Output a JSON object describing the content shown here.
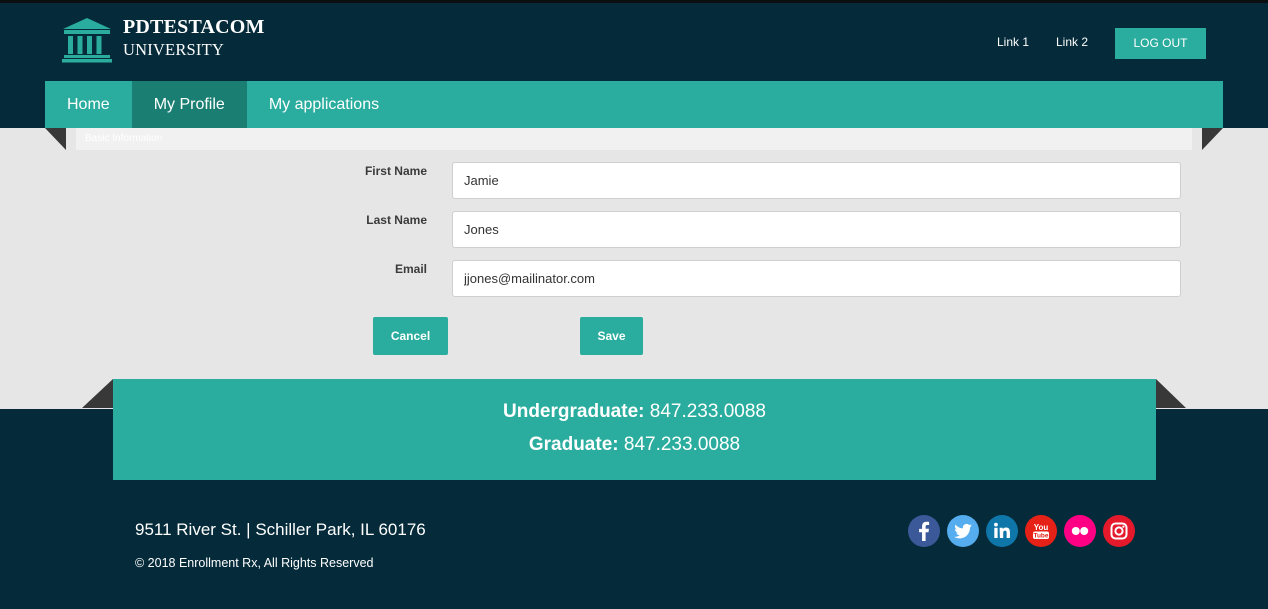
{
  "header": {
    "logo_line1": "PDTESTACOM",
    "logo_line2": "UNIVERSITY",
    "link1": "Link 1",
    "link2": "Link 2",
    "logout_label": "LOG OUT"
  },
  "nav": {
    "items": [
      {
        "label": "Home",
        "active": false
      },
      {
        "label": "My Profile",
        "active": true
      },
      {
        "label": "My applications",
        "active": false
      }
    ]
  },
  "section": {
    "title": "Basic Information"
  },
  "form": {
    "first_name_label": "First Name",
    "first_name_value": "Jamie",
    "last_name_label": "Last Name",
    "last_name_value": "Jones",
    "email_label": "Email",
    "email_value": "jjones@mailinator.com",
    "cancel_label": "Cancel",
    "save_label": "Save"
  },
  "phones": {
    "undergrad_label": "Undergraduate:",
    "undergrad_number": "847.233.0088",
    "grad_label": "Graduate:",
    "grad_number": "847.233.0088"
  },
  "footer": {
    "address": "9511 River St. | Schiller Park, IL 60176",
    "copyright": "© 2018 Enrollment Rx, All Rights Reserved",
    "social": [
      "facebook",
      "twitter",
      "linkedin",
      "youtube",
      "flickr",
      "instagram"
    ]
  },
  "colors": {
    "header_bg": "#052b3a",
    "accent": "#2aad9e",
    "nav_active": "#1a7f72",
    "main_bg": "#e6e6e6",
    "facebook": "#3b5998",
    "twitter": "#55acee",
    "linkedin": "#0e76a8",
    "youtube": "#e62117",
    "flickr": "#ff0084",
    "instagram": "#e4192b"
  }
}
